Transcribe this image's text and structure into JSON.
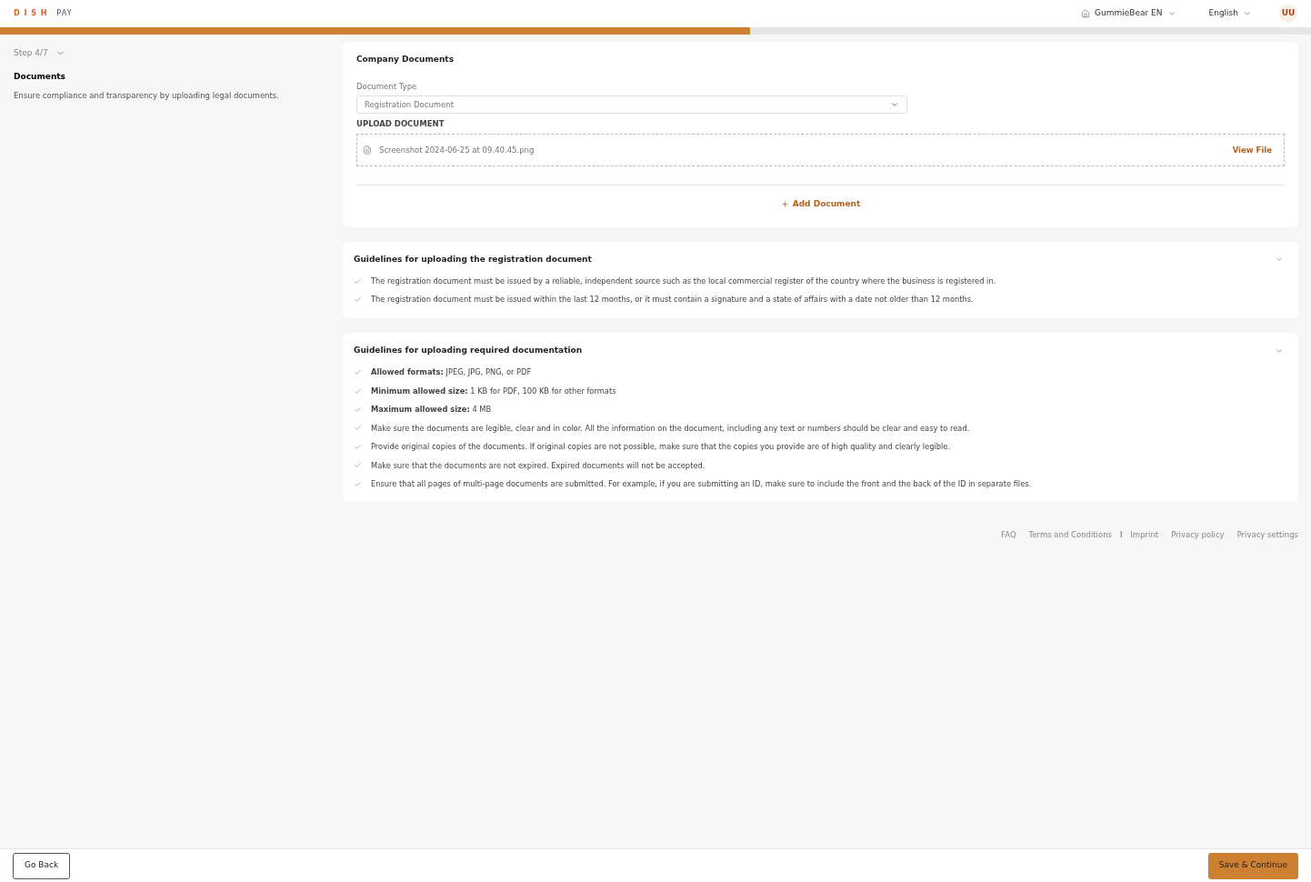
{
  "header": {
    "logo": {
      "brand": "DISH",
      "suffix": "PAY"
    },
    "workspace": "GummieBear EN",
    "language": "English",
    "avatar": "UU"
  },
  "progress": {
    "level": 0.572
  },
  "sidebar": {
    "step": "Step 4/7",
    "title": "Documents",
    "description": "Ensure compliance and transparency by uploading legal documents."
  },
  "company_documents": {
    "title": "Company Documents",
    "document_type_label": "Document Type",
    "document_type_value": "Registration Document",
    "upload_label": "UPLOAD DOCUMENT",
    "file_name": "Screenshot 2024-06-25 at 09.40.45.png",
    "view_file": "View File",
    "add_document": "Add Document"
  },
  "guidelines": [
    {
      "title": "Guidelines for uploading the registration document",
      "expanded": true,
      "items": [
        "The registration document must be issued by a reliable, independent source such as the local commercial register of the country where the business is registered in.",
        "The registration document must be issued within the last 12 months, or it must contain a signature and a state of affairs with a date not older than 12 months."
      ]
    },
    {
      "title": "Guidelines for uploading required documentation",
      "expanded": true,
      "items": [
        "**Allowed formats:** JPEG, JPG, PNG, or PDF",
        "**Minimum allowed size:** 1 KB for PDF, 100 KB for other formats",
        "**Maximum allowed size:** 4 MB",
        "Make sure the documents are legible, clear and in color. All the information on the document, including any text or numbers should be clear and easy to read.",
        "Provide original copies of the documents. If original copies are not possible, make sure that the copies you provide are of high quality and clearly legible.",
        "Make sure that the documents are not expired. Expired documents will not be accepted.",
        "Ensure that all pages of multi-page documents are submitted. For example, if you are submitting an ID, make sure to include the front and the back of the ID in separate files."
      ]
    }
  ],
  "footer_links": [
    {
      "kind": "link",
      "text": "FAQ"
    },
    {
      "kind": "link",
      "text": "Terms and Conditions"
    },
    {
      "kind": "separator",
      "text": "I"
    },
    {
      "kind": "link",
      "text": "Imprint"
    },
    {
      "kind": "link",
      "text": "Privacy policy"
    },
    {
      "kind": "link",
      "text": "Privacy settings"
    }
  ],
  "actions": {
    "back": "Go Back",
    "save": "Save & Continue"
  }
}
